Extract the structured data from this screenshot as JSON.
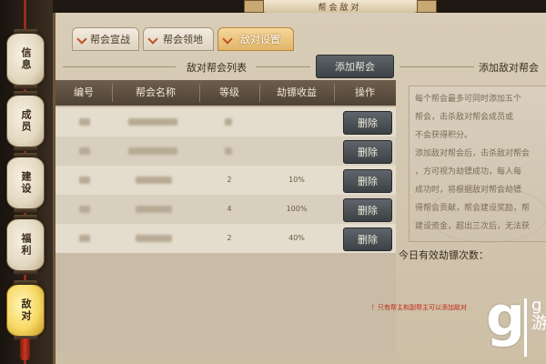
{
  "banner": {
    "title": "帮会敌对"
  },
  "sidebar": {
    "items": [
      {
        "label": "信息",
        "active": false
      },
      {
        "label": "成员",
        "active": false
      },
      {
        "label": "建设",
        "active": false
      },
      {
        "label": "福利",
        "active": false
      },
      {
        "label": "敌对",
        "active": true
      }
    ]
  },
  "tabs": [
    {
      "label": "帮会宣战",
      "active": false
    },
    {
      "label": "帮会领地",
      "active": false
    },
    {
      "label": "敌对设置",
      "active": true
    }
  ],
  "list": {
    "title": "敌对帮会列表",
    "add_button": "添加帮会",
    "headers": [
      "编号",
      "帮会名称",
      "等级",
      "劫镖收益",
      "操作"
    ],
    "rows": [
      {
        "level": "",
        "income": "",
        "action": "删除"
      },
      {
        "level": "",
        "income": "",
        "action": "删除"
      },
      {
        "level": "2",
        "income": "10%",
        "action": "删除"
      },
      {
        "level": "4",
        "income": "100%",
        "action": "删除"
      },
      {
        "level": "2",
        "income": "40%",
        "action": "删除"
      }
    ]
  },
  "right": {
    "title": "添加敌对帮会",
    "info_lines": [
      "每个帮会最多可同时添加五个",
      "帮会，击杀敌对帮会成员或",
      "不会获得积分。",
      "添加敌对帮会后，击杀敌对帮会",
      "，方可视为劫镖成功，每人每",
      "成功时，将根据敌对帮会劫镖",
      "得帮会贡献，帮会建设奖励，帮",
      "建设资金，超出三次后，无法获"
    ],
    "count_label": "今日有效劫镖次数：",
    "warning": "！只有帮主和副帮主可以添加敌对"
  },
  "watermark": {
    "mark": "g",
    "small_top": "g",
    "small_bottom": "游"
  }
}
